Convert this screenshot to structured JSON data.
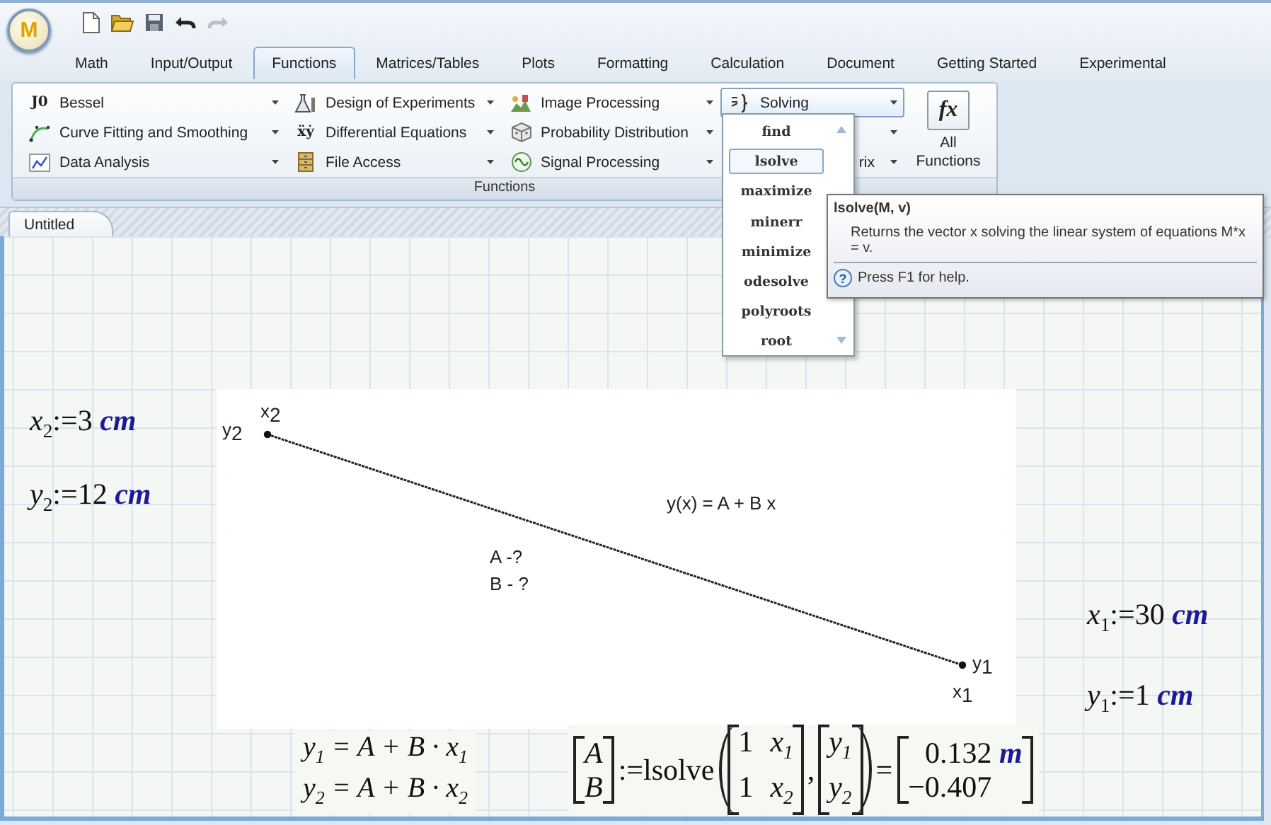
{
  "app": {
    "logo": "M"
  },
  "tabs": [
    {
      "label": "Math",
      "selected": false
    },
    {
      "label": "Input/Output",
      "selected": false
    },
    {
      "label": "Functions",
      "selected": true
    },
    {
      "label": "Matrices/Tables",
      "selected": false
    },
    {
      "label": "Plots",
      "selected": false
    },
    {
      "label": "Formatting",
      "selected": false
    },
    {
      "label": "Calculation",
      "selected": false
    },
    {
      "label": "Document",
      "selected": false
    },
    {
      "label": "Getting Started",
      "selected": false
    },
    {
      "label": "Experimental",
      "selected": false
    }
  ],
  "ribbon": {
    "group_label": "Functions",
    "columns": [
      {
        "items": [
          {
            "kind": "menu",
            "label": "Bessel",
            "icon_text": "J0",
            "expanded": false
          },
          {
            "kind": "menu",
            "label": "Curve Fitting and Smoothing",
            "expanded": false
          },
          {
            "kind": "menu",
            "label": "Data Analysis",
            "expanded": false
          }
        ]
      },
      {
        "items": [
          {
            "kind": "menu",
            "label": "Design of Experiments",
            "expanded": false
          },
          {
            "kind": "menu",
            "label": "Differential Equations",
            "icon_text": "ẍẏ",
            "expanded": false
          },
          {
            "kind": "menu",
            "label": "File Access",
            "expanded": false
          }
        ]
      },
      {
        "items": [
          {
            "kind": "menu",
            "label": "Image Processing",
            "expanded": false
          },
          {
            "kind": "menu",
            "label": "Probability Distribution",
            "expanded": false
          },
          {
            "kind": "menu",
            "label": "Signal Processing",
            "expanded": false
          }
        ]
      },
      {
        "items": [
          {
            "kind": "menu",
            "label": "Solving",
            "expanded": true
          },
          {
            "kind": "covered"
          },
          {
            "kind": "covered",
            "label": "rix"
          }
        ]
      }
    ],
    "all_functions": {
      "icon_text": "fx",
      "label": "All Functions"
    }
  },
  "document_tab": {
    "label": "Untitled"
  },
  "solving_menu": [
    {
      "label": "find",
      "selected": false
    },
    {
      "label": "lsolve",
      "selected": true
    },
    {
      "label": "maximize",
      "selected": false
    },
    {
      "label": "minerr",
      "selected": false
    },
    {
      "label": "minimize",
      "selected": false
    },
    {
      "label": "odesolve",
      "selected": false
    },
    {
      "label": "polyroots",
      "selected": false
    },
    {
      "label": "root",
      "selected": false
    }
  ],
  "tooltip": {
    "title": "lsolve(M, v)",
    "description": "Returns the vector x solving the linear system of equations M*x = v.",
    "help_glyph": "?",
    "help": "Press F1 for help."
  },
  "assignments": [
    {
      "variable": "x",
      "subscript": "2",
      "operator": ":=",
      "value": "3",
      "unit": "cm"
    },
    {
      "variable": "y",
      "subscript": "2",
      "operator": ":=",
      "value": "12",
      "unit": "cm"
    },
    {
      "variable": "x",
      "subscript": "1",
      "operator": ":=",
      "value": "30",
      "unit": "cm"
    },
    {
      "variable": "y",
      "subscript": "1",
      "operator": ":=",
      "value": "1",
      "unit": "cm"
    }
  ],
  "diagram": {
    "labels": [
      "x2",
      "y2",
      "y(x) = A + B x",
      "A -?",
      "B - ?",
      "y1",
      "x1"
    ]
  },
  "equations": [
    "y$_{1}$ = A + B · x$_{1}$",
    "y$_{2}$ = A + B · x$_{2}$"
  ],
  "solve": {
    "lhs": [
      "A",
      "B"
    ],
    "operator": ":=",
    "function": "lsolve",
    "matrix": [
      [
        "1",
        "x$_{1}$"
      ],
      [
        "1",
        "x$_{2}$"
      ]
    ],
    "separator": ",",
    "vector": [
      "y$_{1}$",
      "y$_{2}$"
    ],
    "equals": "=",
    "result": [
      "0.132",
      "−0.407"
    ],
    "result_unit": "m"
  }
}
